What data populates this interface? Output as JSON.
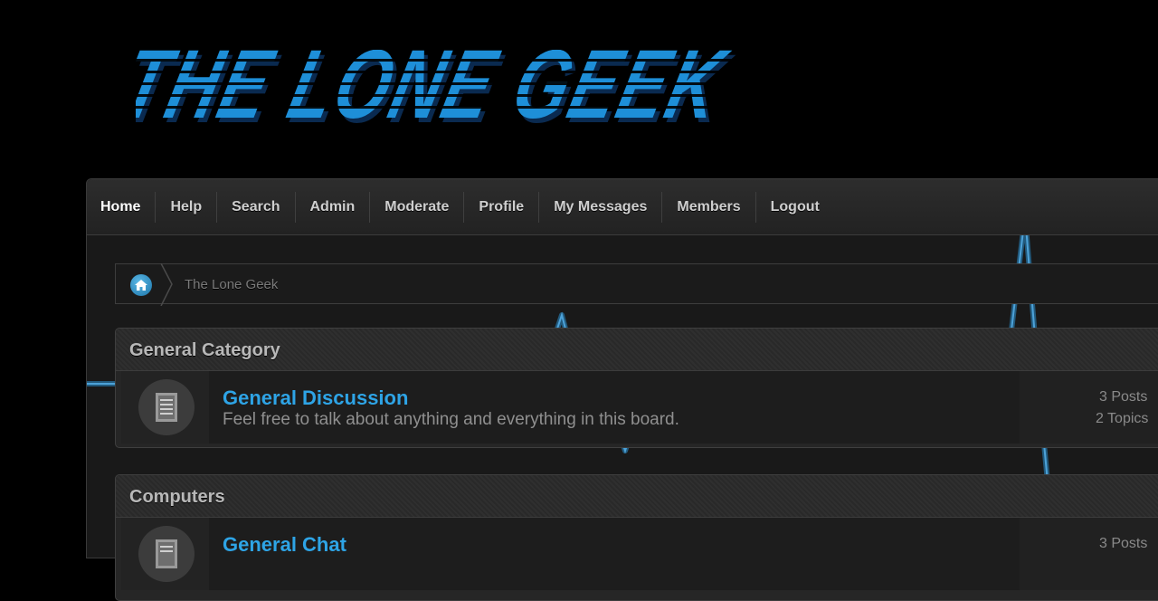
{
  "site": {
    "logo_text": "THE LONE GEEK"
  },
  "nav": {
    "items": [
      "Home",
      "Help",
      "Search",
      "Admin",
      "Moderate",
      "Profile",
      "My Messages",
      "Members",
      "Logout"
    ]
  },
  "breadcrumb": {
    "home_icon": "home-icon",
    "current": "The Lone Geek"
  },
  "categories": [
    {
      "title": "General Category",
      "boards": [
        {
          "title": "General Discussion",
          "description": "Feel free to talk about anything and everything in this board.",
          "posts": "3 Posts",
          "topics": "2 Topics",
          "icon": "board-document-icon"
        }
      ]
    },
    {
      "title": "Computers",
      "boards": [
        {
          "title": "General Chat",
          "description": "",
          "posts": "3 Posts",
          "topics": "",
          "icon": "board-document-icon"
        }
      ]
    }
  ],
  "colors": {
    "logo_blue": "#1e90d8",
    "link_blue": "#2ea4e6",
    "pulse_blue": "#2a8fd0"
  }
}
